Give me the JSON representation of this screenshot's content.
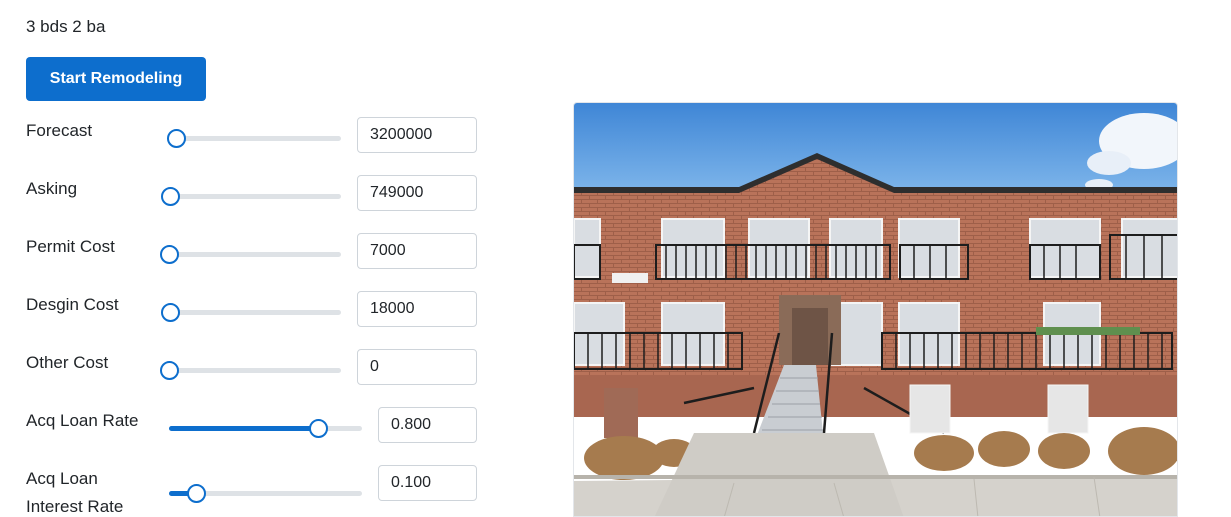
{
  "listing": {
    "beds_baths": "3 bds 2 ba"
  },
  "actions": {
    "start_remodeling_label": "Start Remodeling"
  },
  "fields": {
    "forecast": {
      "label": "Forecast",
      "value": "3200000",
      "slider_fraction": 0.0
    },
    "asking": {
      "label": "Asking",
      "value": "749000",
      "slider_fraction": 0.0
    },
    "permit_cost": {
      "label": "Permit Cost",
      "value": "7000",
      "slider_fraction": 0.0
    },
    "design_cost": {
      "label": "Desgin Cost",
      "value": "18000",
      "slider_fraction": 0.0
    },
    "other_cost": {
      "label": "Other Cost",
      "value": "0",
      "slider_fraction": 0.0
    },
    "acq_loan_rate": {
      "label": "Acq Loan Rate",
      "value": "0.800",
      "slider_fraction": 0.8
    },
    "acq_loan_interest_rate": {
      "label_line1": "Acq Loan",
      "label_line2": "Interest Rate",
      "value": "0.100",
      "slider_fraction": 0.1
    }
  },
  "colors": {
    "accent": "#0d6ecd",
    "track": "#dee2e6",
    "input_border": "#ced4da"
  }
}
